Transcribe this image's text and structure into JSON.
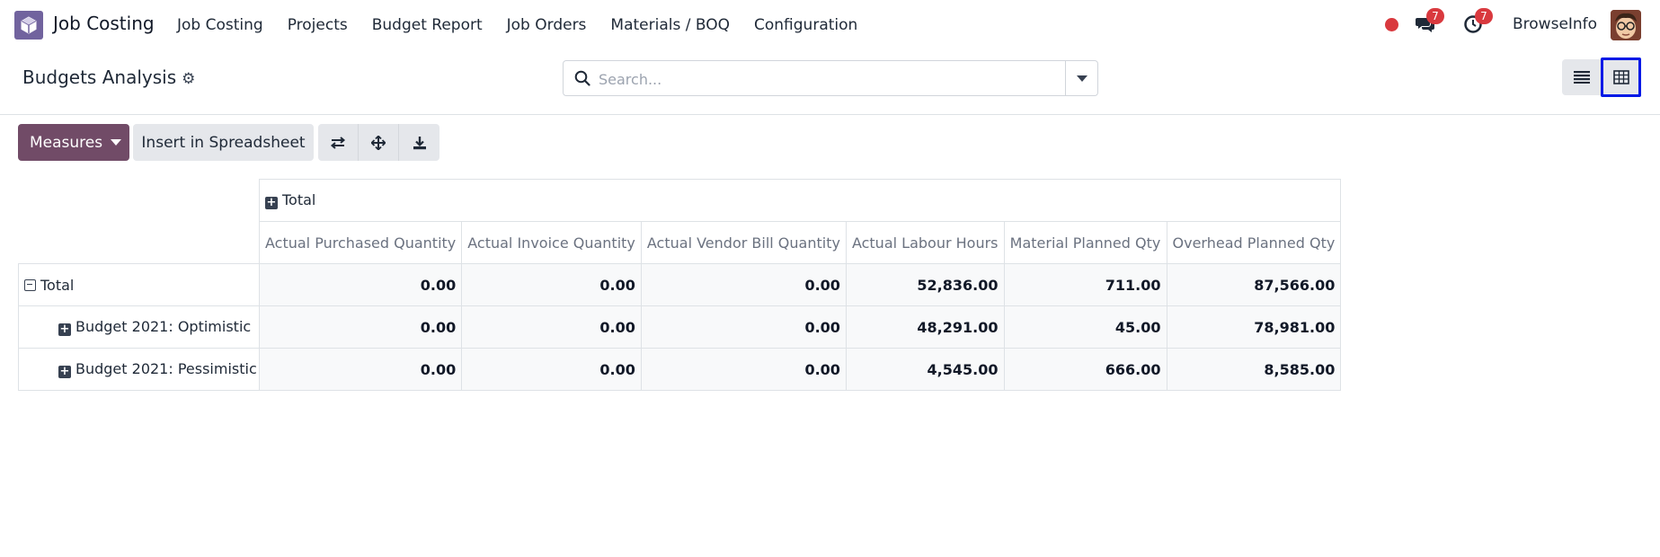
{
  "navbar": {
    "app_name": "Job Costing",
    "menu": [
      "Job Costing",
      "Projects",
      "Budget Report",
      "Job Orders",
      "Materials / BOQ",
      "Configuration"
    ],
    "messages_badge": "7",
    "activities_badge": "7",
    "user_name": "BrowseInfo"
  },
  "control_panel": {
    "title": "Budgets Analysis",
    "search_placeholder": "Search..."
  },
  "toolbar": {
    "measures_label": "Measures",
    "insert_label": "Insert in Spreadsheet"
  },
  "pivot": {
    "col_header": "Total",
    "measures": [
      "Actual Purchased Quantity",
      "Actual Invoice Quantity",
      "Actual Vendor Bill Quantity",
      "Actual Labour Hours",
      "Material Planned Qty",
      "Overhead Planned Qty"
    ],
    "rows": [
      {
        "label": "Total",
        "values": [
          "0.00",
          "0.00",
          "0.00",
          "52,836.00",
          "711.00",
          "87,566.00"
        ]
      },
      {
        "label": "Budget 2021: Optimistic",
        "values": [
          "0.00",
          "0.00",
          "0.00",
          "48,291.00",
          "45.00",
          "78,981.00"
        ]
      },
      {
        "label": "Budget 2021: Pessimistic",
        "values": [
          "0.00",
          "0.00",
          "0.00",
          "4,545.00",
          "666.00",
          "8,585.00"
        ]
      }
    ]
  },
  "colors": {
    "brand": "#714b67",
    "badge": "#d9393e",
    "active_view_outline": "#0019e6"
  }
}
